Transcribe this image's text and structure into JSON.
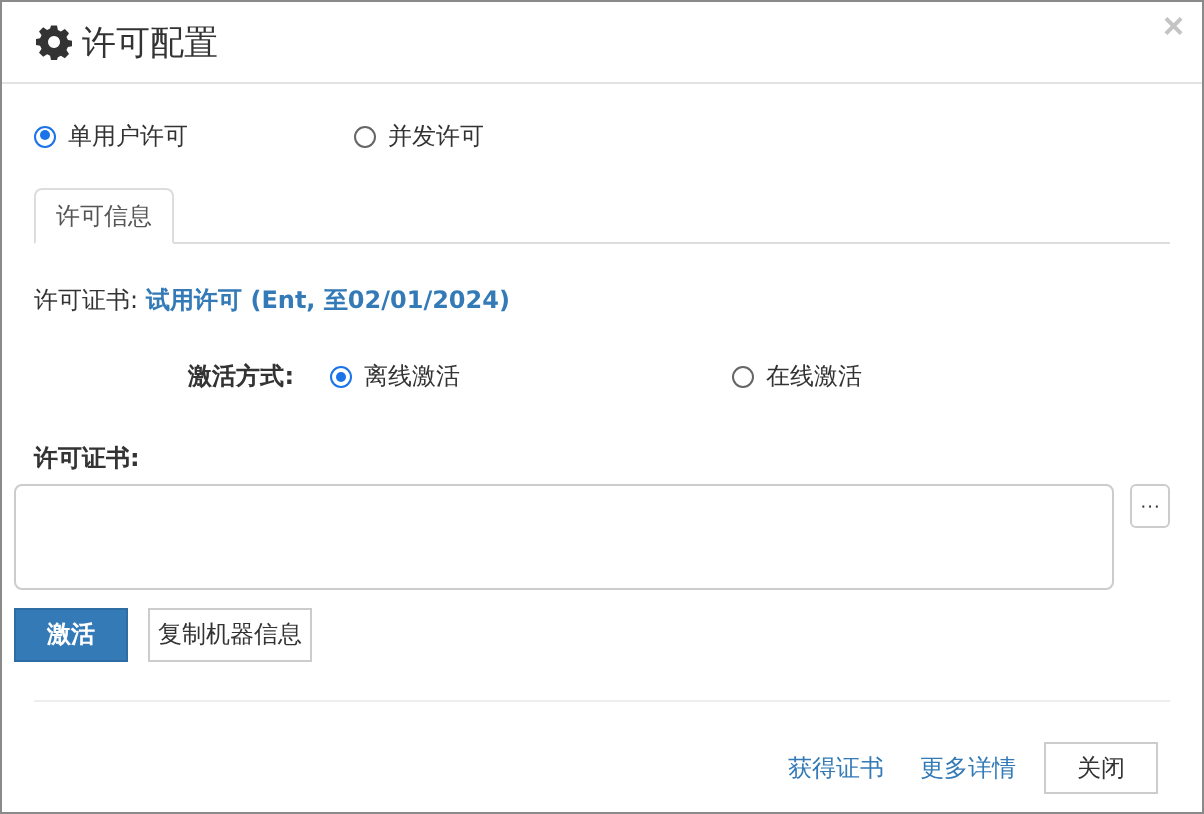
{
  "window": {
    "title": "许可配置",
    "close": "×"
  },
  "license_types": [
    {
      "label": "单用户许可",
      "selected": true
    },
    {
      "label": "并发许可",
      "selected": false
    }
  ],
  "tabs": [
    {
      "label": "许可信息",
      "selected": true
    }
  ],
  "license": {
    "label": "许可证书:",
    "value": "试用许可 (Ent, 至02/01/2024)"
  },
  "activation": {
    "label": "激活方式:",
    "options": [
      {
        "label": "离线激活",
        "selected": true
      },
      {
        "label": "在线激活",
        "selected": false
      }
    ]
  },
  "certificate": {
    "label": "许可证书:",
    "browse": "···"
  },
  "actions": [
    {
      "label": "激活",
      "kind": "primary"
    },
    {
      "label": "复制机器信息",
      "kind": "default"
    }
  ],
  "footer": {
    "links": [
      "获得证书",
      "更多详情"
    ],
    "close_button": "关闭"
  }
}
